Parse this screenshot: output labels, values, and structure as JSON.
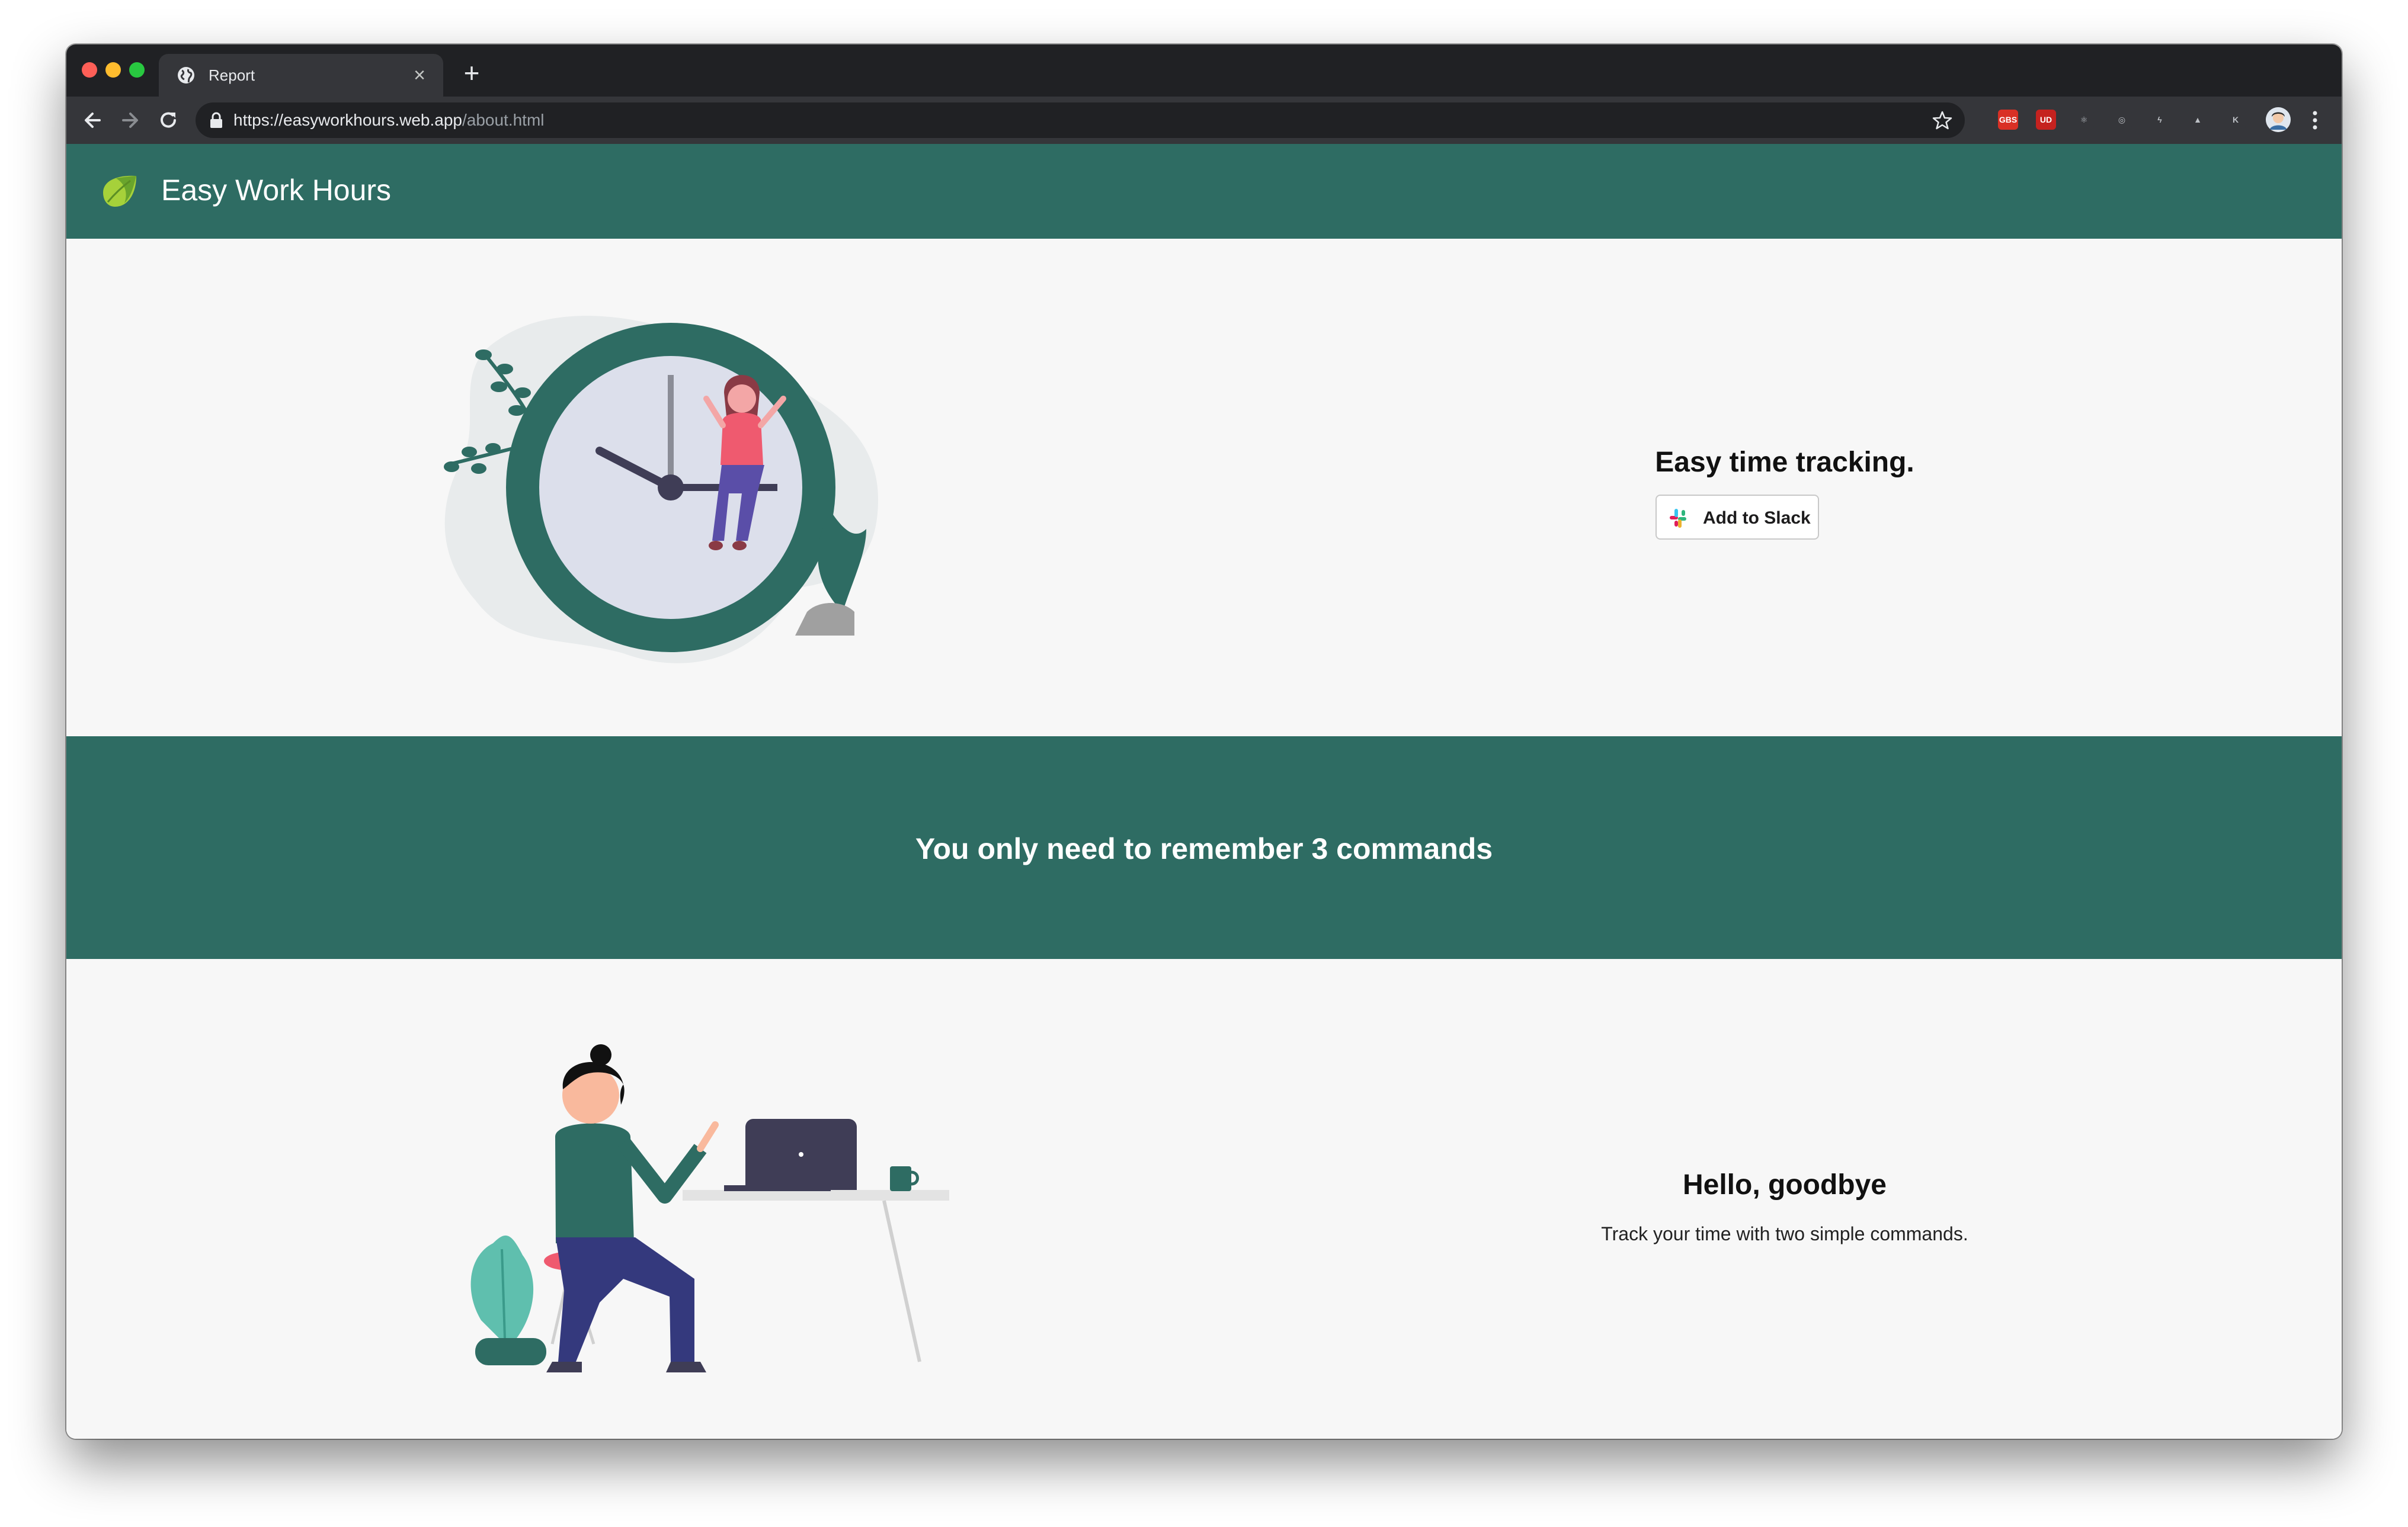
{
  "browser": {
    "tab": {
      "title": "Report",
      "close_glyph": "×"
    },
    "new_tab_glyph": "+",
    "url": {
      "host": "https://easyworkhours.web.app",
      "path": "/about.html"
    },
    "extensions": [
      {
        "name": "gbs-extension-icon",
        "label": "GBS",
        "color": "#d93025"
      },
      {
        "name": "ublock-extension-icon",
        "label": "UD",
        "color": "#c5221f"
      },
      {
        "name": "react-devtools-icon",
        "label": "⚛",
        "color": "#35363a"
      },
      {
        "name": "target-extension-icon",
        "label": "◎",
        "color": "#35363a"
      },
      {
        "name": "bolt-extension-icon",
        "label": "ϟ",
        "color": "#35363a"
      },
      {
        "name": "android-extension-icon",
        "label": "▲",
        "color": "#35363a"
      },
      {
        "name": "k-extension-icon",
        "label": "K",
        "color": "#35363a"
      }
    ]
  },
  "header": {
    "brand": "Easy Work Hours"
  },
  "hero": {
    "title": "Easy time tracking.",
    "button_label": "Add to Slack"
  },
  "band": {
    "title": "You only need to remember 3 commands"
  },
  "feature": {
    "title": "Hello, goodbye",
    "description": "Track your time with two simple commands."
  },
  "colors": {
    "brand_green": "#2e6c63",
    "background": "#f7f7f7",
    "accent_pink": "#ef5a6f"
  }
}
